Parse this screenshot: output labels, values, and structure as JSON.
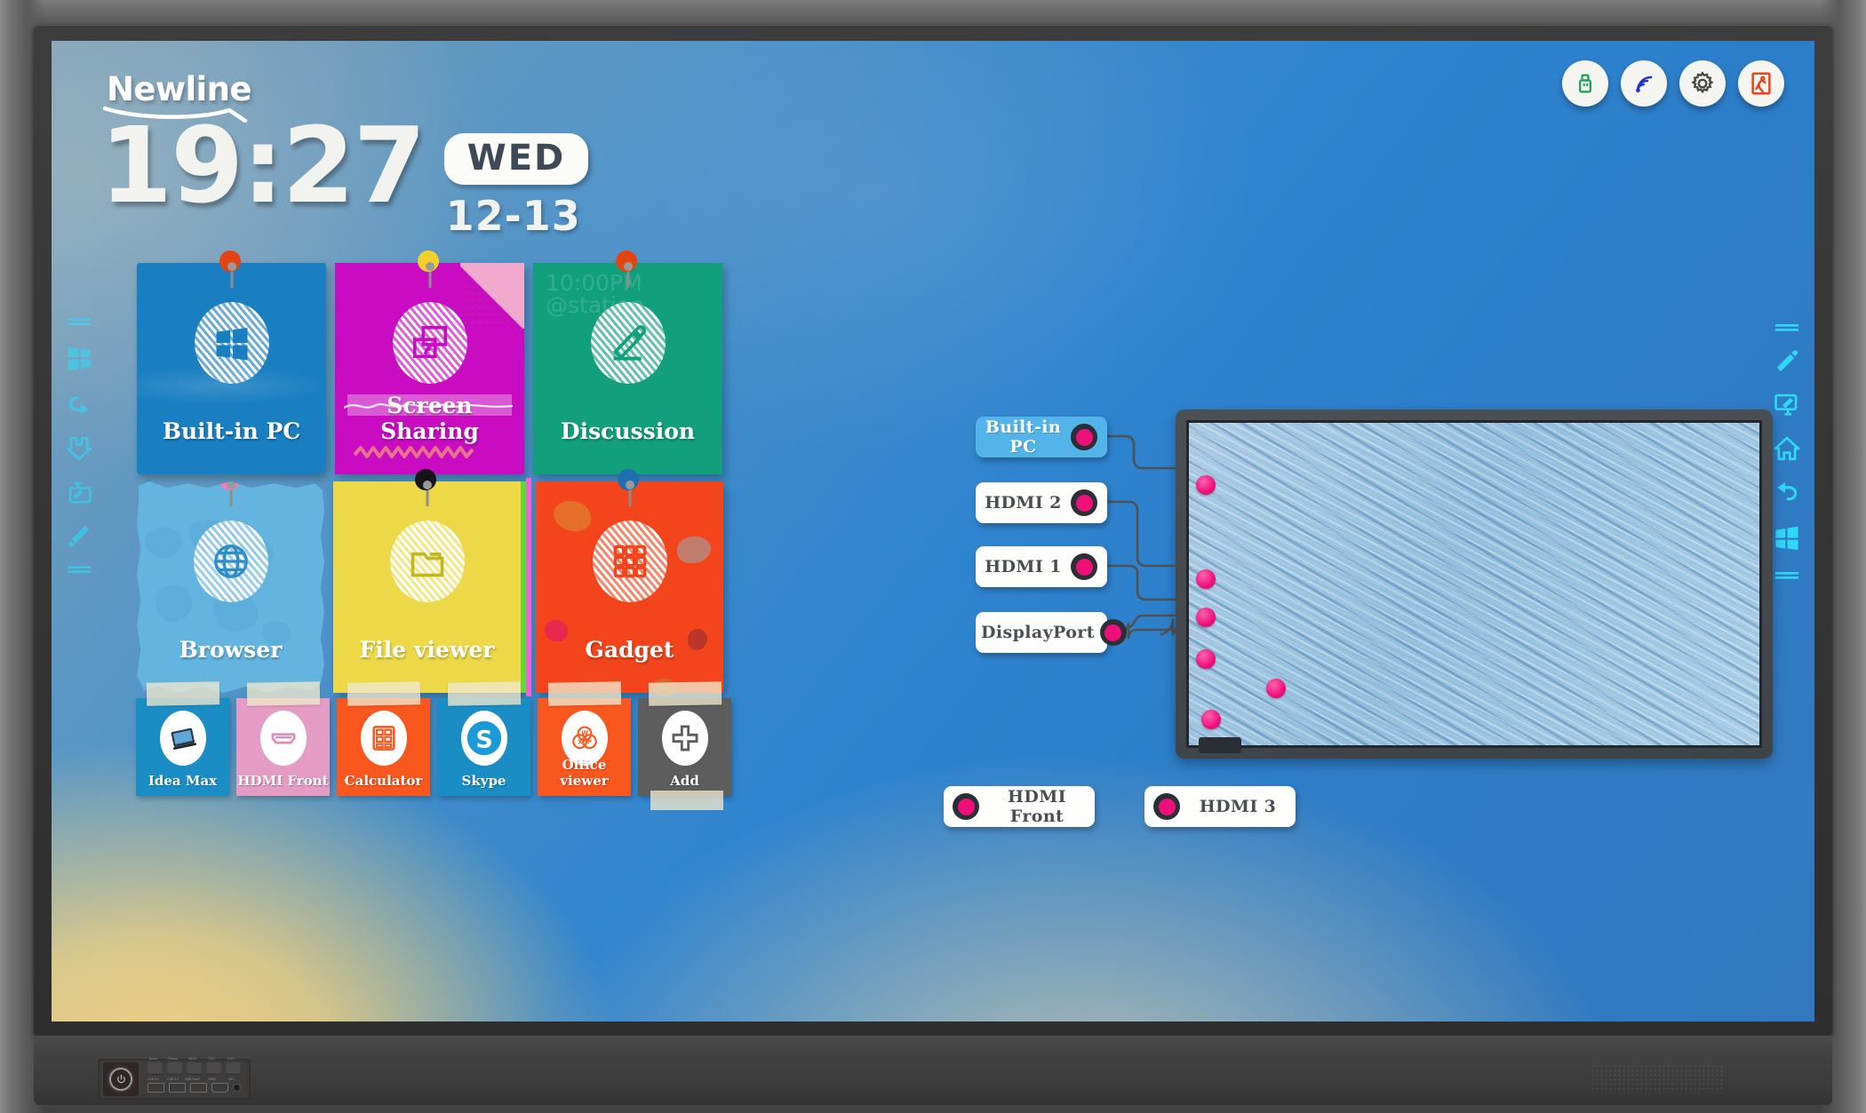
{
  "brand": {
    "name": "Newline"
  },
  "clock": {
    "time": "19:27",
    "weekday": "WED",
    "date": "12-13"
  },
  "status_icons": [
    {
      "name": "usb-icon",
      "label": "USB",
      "color": "#1aa35a"
    },
    {
      "name": "wifi-icon",
      "label": "WiFi",
      "color": "#2433c4"
    },
    {
      "name": "settings-gear-icon",
      "label": "Settings",
      "color": "#4a4a4a"
    },
    {
      "name": "exit-icon",
      "label": "Exit",
      "color": "#e8431d"
    }
  ],
  "sidebar": {
    "items": [
      {
        "name": "menu-handle-icon",
        "label": "Menu"
      },
      {
        "name": "pen-icon",
        "label": "Pen"
      },
      {
        "name": "annotate-screen-icon",
        "label": "Annotate"
      },
      {
        "name": "home-icon",
        "label": "Home"
      },
      {
        "name": "back-icon",
        "label": "Back"
      },
      {
        "name": "apps-windows-icon",
        "label": "Apps"
      },
      {
        "name": "menu-handle-icon",
        "label": "Menu"
      }
    ]
  },
  "tiles": [
    {
      "label": "Built-in PC",
      "icon": "windows-icon",
      "color": "#1a7fc1",
      "pin_color": "#e34512"
    },
    {
      "label": "Screen Sharing",
      "icon": "screen-cast-icon",
      "color": "#c90cc2",
      "pin_color": "#f2d22a"
    },
    {
      "label": "Discussion",
      "icon": "pencil-icon",
      "color": "#11a07b",
      "pin_color": "#e34512",
      "note": "10:00PM\n@station"
    },
    {
      "label": "Browser",
      "icon": "globe-icon",
      "color": "#64b4e0",
      "pin_color": "#ef7fb5"
    },
    {
      "label": "File viewer",
      "icon": "folder-icon",
      "color": "#edd948",
      "pin_color": "#151515"
    },
    {
      "label": "Gadget",
      "icon": "grid-apps-icon",
      "color": "#f4441b",
      "pin_color": "#1e6fb0"
    }
  ],
  "dock": [
    {
      "label": "Idea Max",
      "icon": "whiteboard-icon",
      "color": "#1a8ec4"
    },
    {
      "label": "HDMI Front",
      "icon": "hdmi-port-icon",
      "color": "#e49bc4"
    },
    {
      "label": "Calculator",
      "icon": "calculator-icon",
      "color": "#f9571d"
    },
    {
      "label": "Skype",
      "icon": "skype-icon",
      "color": "#1a8ec4"
    },
    {
      "label": "Office viewer",
      "icon": "office-icon",
      "color": "#f9571d"
    },
    {
      "label": "Add",
      "icon": "plus-icon",
      "color": "#5d5d5d"
    }
  ],
  "sources": {
    "left_column": [
      {
        "label": "Built-in PC",
        "active": true
      },
      {
        "label": "HDMI 2",
        "active": false
      },
      {
        "label": "HDMI 1",
        "active": false
      },
      {
        "label": "DisplayPort",
        "active": false
      }
    ],
    "bottom_row": [
      {
        "label": "HDMI Front",
        "active": false
      },
      {
        "label": "HDMI 3",
        "active": false
      }
    ],
    "jack_color": "#ef0f79"
  },
  "hardware": {
    "buttons": [
      "Home",
      "Return",
      "Menu",
      "VOL-",
      "VOL+"
    ],
    "ports": [
      "USB 3.0",
      "USB 3.0",
      "USB Touch",
      "HDMI",
      "MIC"
    ],
    "power_label": "Power"
  }
}
